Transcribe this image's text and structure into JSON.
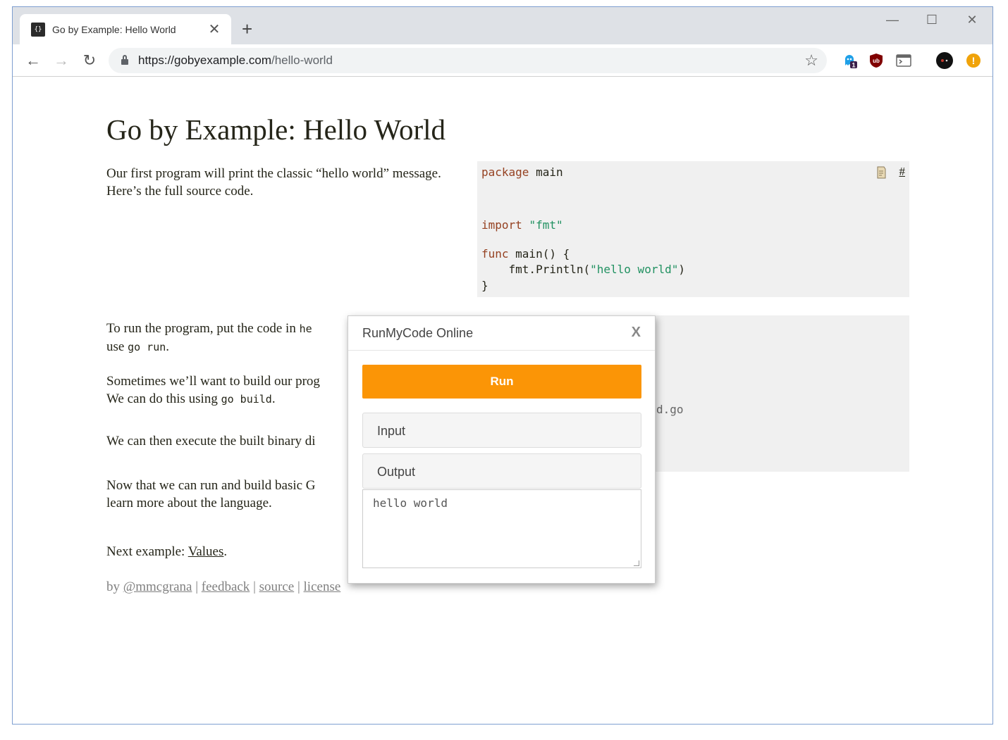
{
  "browser": {
    "tab_title": "Go by Example: Hello World",
    "favicon_text": "{}",
    "tab_close": "✕",
    "new_tab": "+",
    "url_host": "https://gobyexample.com",
    "url_path": "/hello-world",
    "window_controls": {
      "minimize": "—",
      "maximize": "☐",
      "close": "✕"
    },
    "extensions": [
      {
        "name": "ghostery-icon",
        "badge": "1"
      },
      {
        "name": "ublock-icon",
        "text": "ub"
      },
      {
        "name": "terminal-icon"
      },
      {
        "name": "profile-avatar-icon"
      },
      {
        "name": "update-warning-icon",
        "text": "!"
      }
    ]
  },
  "page": {
    "title": "Go by Example: Hello World",
    "intro": "Our first program will print the classic “hello world” message. Here’s the full source code.",
    "code": {
      "line1_kw": "package",
      "line1_rest": " main",
      "line2_kw": "import",
      "line2_str": "\"fmt\"",
      "line3_kw": "func",
      "line3_rest": " main() {",
      "line4_pre": "    fmt.Println(",
      "line4_str": "\"hello world\"",
      "line4_post": ")",
      "line5": "}"
    },
    "code_links": {
      "run_icon": "run-code-icon",
      "anchor": "#"
    },
    "run_text_1": "To run the program, put the code in ",
    "run_code_1": "he",
    "run_text_2": "use ",
    "run_code_2": "go run",
    "run_text_3": ".",
    "build_text_1": "Sometimes we’ll want to build our prog",
    "build_text_2": "We can do this using ",
    "build_code": "go build",
    "build_text_3": ".",
    "exec_text": "We can then execute the built binary di",
    "learn_text_1": "Now that we can run and build basic G",
    "learn_text_2": "learn more about the language.",
    "shell_partial": "d.go",
    "next_label": "Next example: ",
    "next_link": "Values",
    "next_period": ".",
    "footer": {
      "by": "by ",
      "author": "@mmcgrana",
      "sep": " | ",
      "feedback": "feedback",
      "source": "source",
      "license": "license"
    }
  },
  "modal": {
    "title": "RunMyCode Online",
    "close": "X",
    "run_label": "Run",
    "input_label": "Input",
    "output_label": "Output",
    "output_value": "hello world"
  }
}
